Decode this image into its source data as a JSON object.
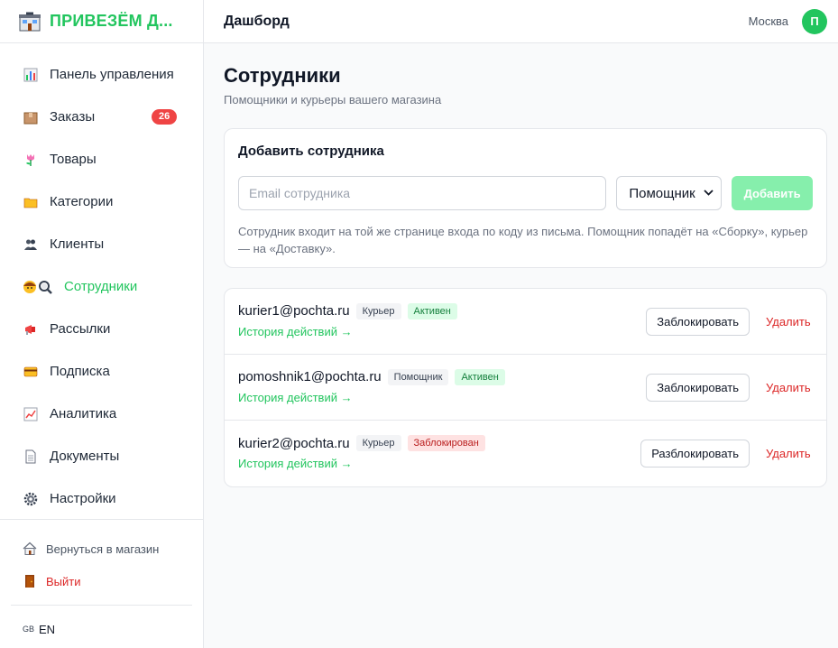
{
  "brand": {
    "title": "ПРИВЕЗЁМ Д..."
  },
  "sidebar": {
    "items": [
      {
        "label": "Панель управления",
        "icon": "bar-chart-icon"
      },
      {
        "label": "Заказы",
        "icon": "package-icon",
        "badge": "26"
      },
      {
        "label": "Товары",
        "icon": "tulip-icon"
      },
      {
        "label": "Категории",
        "icon": "folder-icon"
      },
      {
        "label": "Клиенты",
        "icon": "users-icon"
      },
      {
        "label": "Сотрудники",
        "icon": "staff-icon",
        "active": true
      },
      {
        "label": "Рассылки",
        "icon": "megaphone-icon"
      },
      {
        "label": "Подписка",
        "icon": "credit-card-icon"
      },
      {
        "label": "Аналитика",
        "icon": "trend-chart-icon"
      },
      {
        "label": "Документы",
        "icon": "document-icon"
      },
      {
        "label": "Настройки",
        "icon": "gear-icon"
      }
    ],
    "back_to_store": "Вернуться в магазин",
    "logout": "Выйти",
    "lang_flag": "GB",
    "lang_label": "EN"
  },
  "topbar": {
    "title": "Дашборд",
    "city": "Москва",
    "avatar_letter": "П"
  },
  "page": {
    "title": "Сотрудники",
    "subtitle": "Помощники и курьеры вашего магазина"
  },
  "add_staff": {
    "title": "Добавить сотрудника",
    "email_placeholder": "Email сотрудника",
    "role_selected": "Помощник",
    "add_button": "Добавить",
    "note": "Сотрудник входит на той же странице входа по коду из письма. Помощник попадёт на «Сборку», курьер — на «Доставку»."
  },
  "staff": [
    {
      "email": "kurier1@pochta.ru",
      "role": "Курьер",
      "status": "Активен",
      "status_type": "active",
      "history": "История действий →",
      "action": "Заблокировать",
      "delete": "Удалить"
    },
    {
      "email": "pomoshnik1@pochta.ru",
      "role": "Помощник",
      "status": "Активен",
      "status_type": "active",
      "history": "История действий →",
      "action": "Заблокировать",
      "delete": "Удалить"
    },
    {
      "email": "kurier2@pochta.ru",
      "role": "Курьер",
      "status": "Заблокирован",
      "status_type": "blocked",
      "history": "История действий →",
      "action": "Разблокировать",
      "delete": "Удалить"
    }
  ],
  "colors": {
    "accent": "#22c55e",
    "danger": "#dc2626",
    "badge": "#ef4444"
  }
}
